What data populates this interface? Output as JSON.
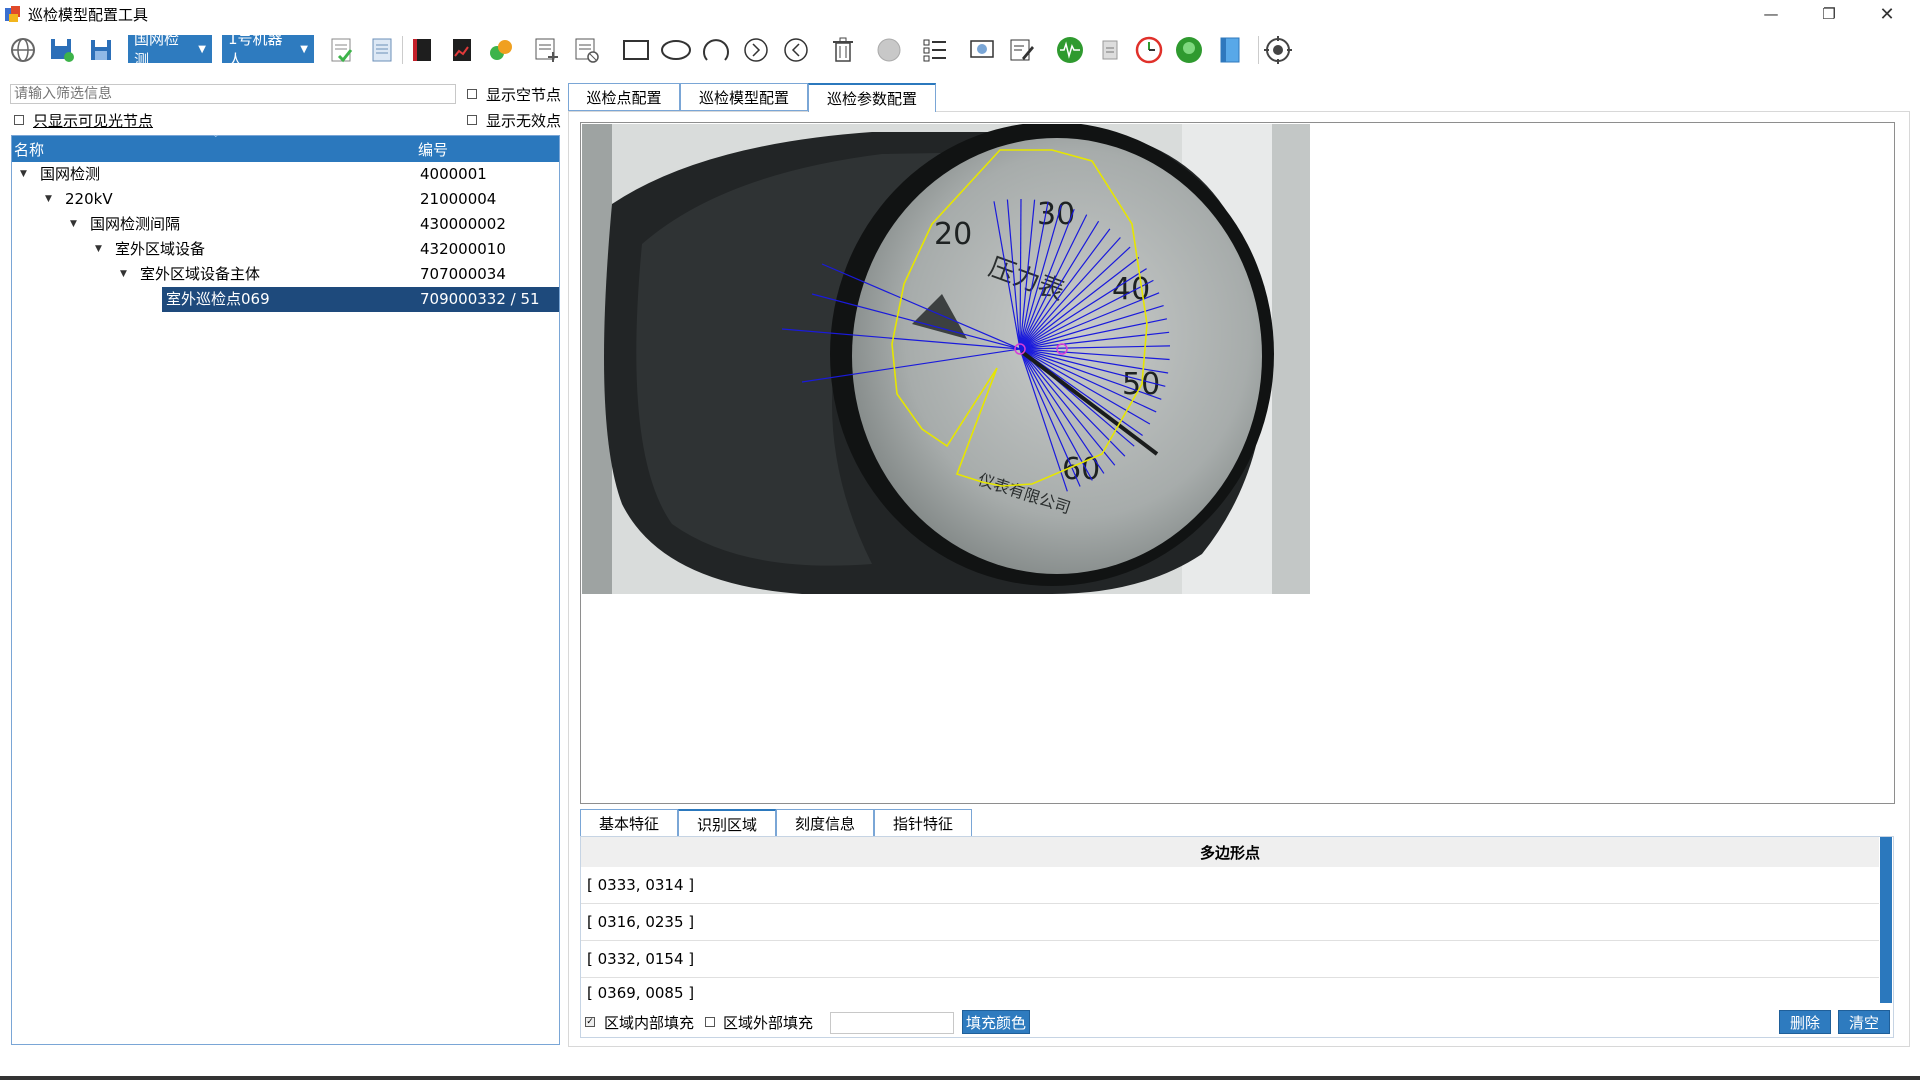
{
  "window": {
    "title": "巡检模型配置工具",
    "minimize": "—",
    "maximize": "❐",
    "close": "✕"
  },
  "toolbar": {
    "dropdown_station": "国网检测",
    "dropdown_robot": "1号机器人",
    "icons": [
      "globe-icon",
      "save-icon",
      "save-as-icon",
      "list-check-icon",
      "document-icon",
      "red-book-icon",
      "chart-book-icon",
      "sync-icon",
      "add-item-icon",
      "remove-item-icon",
      "rectangle-icon",
      "ellipse-icon",
      "arc-icon",
      "arc-right-icon",
      "arc-left-icon",
      "trash-icon",
      "disabled-circle-icon",
      "list-icon",
      "preview-icon",
      "edit-icon",
      "waveform-icon",
      "file-icon",
      "clock-icon",
      "go-icon",
      "panel-icon",
      "target-icon"
    ]
  },
  "left": {
    "filter_placeholder": "请输入筛选信息",
    "show_empty": "显示空节点",
    "show_visible_only": "只显示可见光节点",
    "show_invalid": "显示无效点",
    "tree_headers": {
      "name": "名称",
      "code": "编号"
    },
    "tree_rows": [
      {
        "name": "国网检测",
        "code": "4000001"
      },
      {
        "name": "220kV",
        "code": "21000004"
      },
      {
        "name": "国网检测间隔",
        "code": "430000002"
      },
      {
        "name": "室外区域设备",
        "code": "432000010"
      },
      {
        "name": "室外区域设备主体",
        "code": "707000034"
      },
      {
        "name": "室外巡检点069",
        "code": "709000332 / 51"
      }
    ]
  },
  "tabs": [
    "巡检点配置",
    "巡检模型配置",
    "巡检参数配置"
  ],
  "gauge": {
    "labels": [
      "20",
      "30",
      "40",
      "50",
      "60",
      "压力表",
      "仪表有限公司"
    ]
  },
  "subtabs": [
    "基本特征",
    "识别区域",
    "刻度信息",
    "指针特征"
  ],
  "polygon": {
    "header": "多边形点",
    "points": [
      "[ 0333, 0314 ]",
      "[ 0316, 0235 ]",
      "[ 0332, 0154 ]",
      "[ 0369, 0085 ]"
    ]
  },
  "bottom": {
    "fill_inside": "区域内部填充",
    "fill_outside": "区域外部填充",
    "fill_color_btn": "填充颜色",
    "delete_btn": "删除",
    "clear_btn": "清空"
  },
  "colors": {
    "accent": "#2b78bd",
    "polygon": "#e6e600",
    "rays": "#1a1adc",
    "center": "#d83cd8"
  }
}
